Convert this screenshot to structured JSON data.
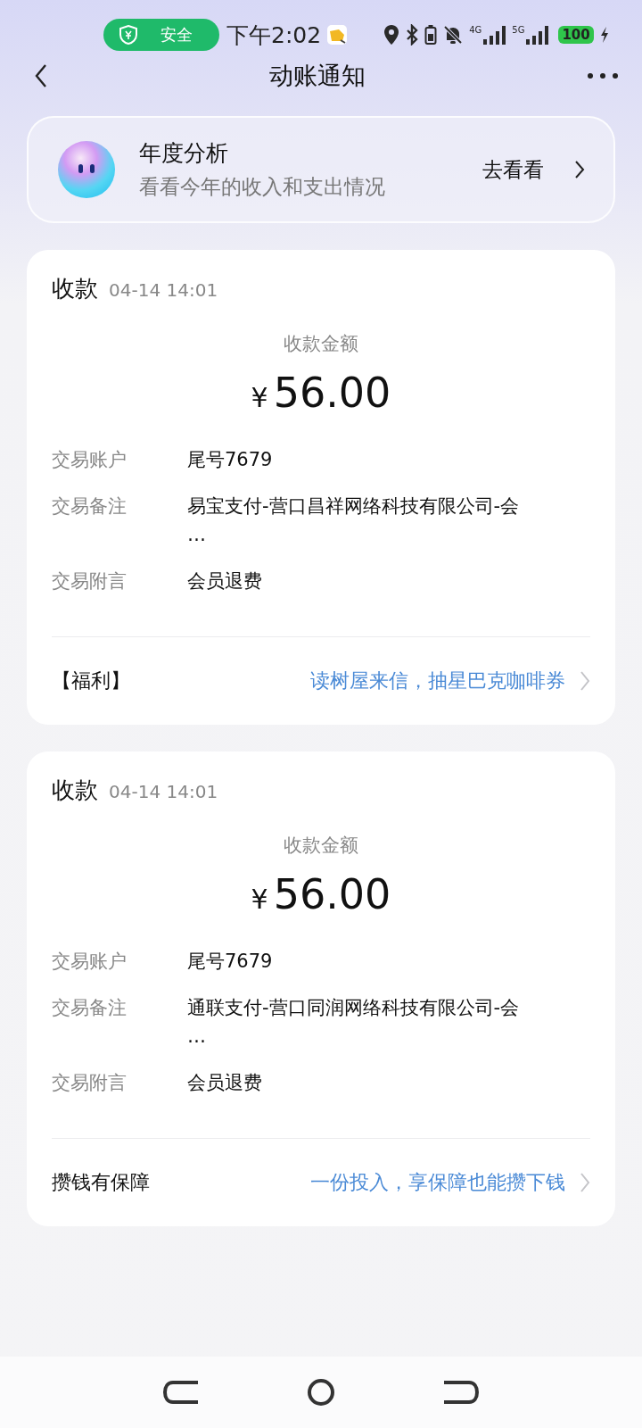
{
  "status_bar": {
    "security_label": "安全",
    "time": "下午2:02",
    "network_1": "4G",
    "network_2": "5G",
    "battery": "100"
  },
  "header": {
    "title": "动账通知"
  },
  "banner": {
    "title": "年度分析",
    "subtitle": "看看今年的收入和支出情况",
    "action": "去看看"
  },
  "notices": [
    {
      "type": "收款",
      "time": "04-14 14:01",
      "amount_label": "收款金额",
      "currency": "¥",
      "amount": "56.00",
      "fields": [
        {
          "label": "交易账户",
          "value": "尾号7679"
        },
        {
          "label": "交易备注",
          "value": "易宝支付-营口昌祥网络科技有限公司-会\n…"
        },
        {
          "label": "交易附言",
          "value": "会员退费"
        }
      ],
      "footer": {
        "label": "【福利】",
        "link": "读树屋来信，抽星巴克咖啡券"
      }
    },
    {
      "type": "收款",
      "time": "04-14 14:01",
      "amount_label": "收款金额",
      "currency": "¥",
      "amount": "56.00",
      "fields": [
        {
          "label": "交易账户",
          "value": "尾号7679"
        },
        {
          "label": "交易备注",
          "value": "通联支付-营口同润网络科技有限公司-会\n…"
        },
        {
          "label": "交易附言",
          "value": "会员退费"
        }
      ],
      "footer": {
        "label": "攒钱有保障",
        "link": "一份投入，享保障也能攒下钱"
      }
    }
  ]
}
